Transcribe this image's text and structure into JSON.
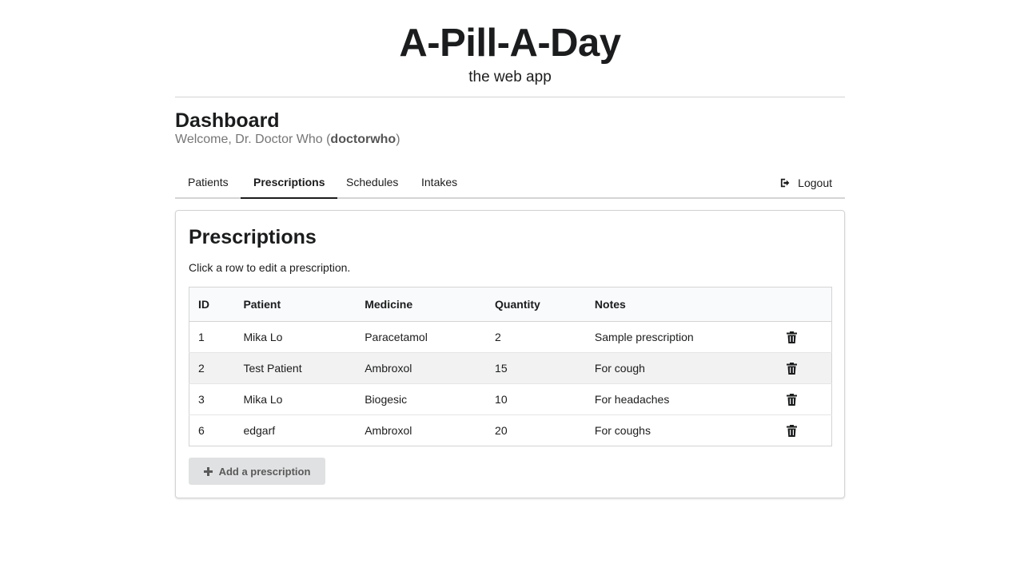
{
  "header": {
    "title": "A-Pill-A-Day",
    "subtitle": "the web app"
  },
  "dashboard": {
    "title": "Dashboard",
    "welcome_prefix": "Welcome, Dr. Doctor Who (",
    "username": "doctorwho",
    "welcome_suffix": ")"
  },
  "tabs": [
    {
      "label": "Patients",
      "active": false
    },
    {
      "label": "Prescriptions",
      "active": true
    },
    {
      "label": "Schedules",
      "active": false
    },
    {
      "label": "Intakes",
      "active": false
    }
  ],
  "logout": {
    "label": "Logout",
    "icon": "sign-out-icon"
  },
  "prescriptions": {
    "title": "Prescriptions",
    "hint": "Click a row to edit a prescription.",
    "columns": [
      "ID",
      "Patient",
      "Medicine",
      "Quantity",
      "Notes"
    ],
    "rows": [
      {
        "id": "1",
        "patient": "Mika Lo",
        "medicine": "Paracetamol",
        "quantity": "2",
        "notes": "Sample prescription"
      },
      {
        "id": "2",
        "patient": "Test Patient",
        "medicine": "Ambroxol",
        "quantity": "15",
        "notes": "For cough"
      },
      {
        "id": "3",
        "patient": "Mika Lo",
        "medicine": "Biogesic",
        "quantity": "10",
        "notes": "For headaches"
      },
      {
        "id": "6",
        "patient": "edgarf",
        "medicine": "Ambroxol",
        "quantity": "20",
        "notes": "For coughs"
      }
    ],
    "delete_icon": "trash-icon",
    "add_button": {
      "label": "Add a prescription",
      "icon": "plus-icon"
    }
  }
}
